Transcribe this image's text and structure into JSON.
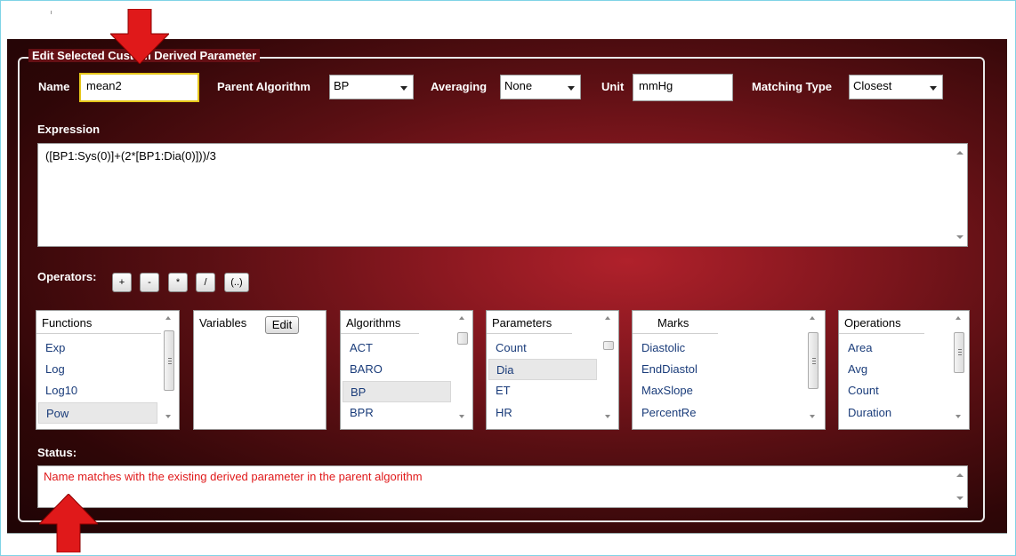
{
  "panel": {
    "group_title": "Edit Selected Custom Derived Parameter"
  },
  "form": {
    "name_label": "Name",
    "name_value": "mean2",
    "parent_algorithm_label": "Parent Algorithm",
    "parent_algorithm_value": "BP",
    "averaging_label": "Averaging",
    "averaging_value": "None",
    "unit_label": "Unit",
    "unit_value": "mmHg",
    "matching_type_label": "Matching Type",
    "matching_type_value": "Closest"
  },
  "expression": {
    "label": "Expression",
    "value": "([BP1:Sys(0)]+(2*[BP1:Dia(0)]))/3"
  },
  "operators": {
    "label": "Operators:",
    "buttons": [
      "+",
      "-",
      "*",
      "/",
      "(..)"
    ]
  },
  "lists": {
    "functions": {
      "header": "Functions",
      "items": [
        "Exp",
        "Log",
        "Log10",
        "Pow"
      ],
      "selected": "Pow"
    },
    "variables": {
      "header": "Variables",
      "edit_label": "Edit",
      "items": []
    },
    "algorithms": {
      "header": "Algorithms",
      "items": [
        "ACT",
        "BARO",
        "BP",
        "BPR"
      ],
      "selected": "BP"
    },
    "parameters": {
      "header": "Parameters",
      "items": [
        "Count",
        "Dia",
        "ET",
        "HR"
      ],
      "selected": "Dia"
    },
    "marks": {
      "header": "Marks",
      "items": [
        "Diastolic",
        "EndDiastol",
        "MaxSlope",
        "PercentRe"
      ]
    },
    "operations": {
      "header": "Operations",
      "items": [
        "Area",
        "Avg",
        "Count",
        "Duration"
      ]
    }
  },
  "status": {
    "label": "Status:",
    "message": "Name matches with the existing derived parameter in the parent algorithm"
  },
  "colors": {
    "annotation_arrow": "#e0191a",
    "highlight_border": "#e6c619",
    "status_text": "#e0191a",
    "list_item_text": "#1a3c7a"
  },
  "icons": {
    "arrow_top": "red-down-arrow-icon",
    "arrow_bottom": "red-up-arrow-icon",
    "dropdown": "chevron-down-icon"
  }
}
